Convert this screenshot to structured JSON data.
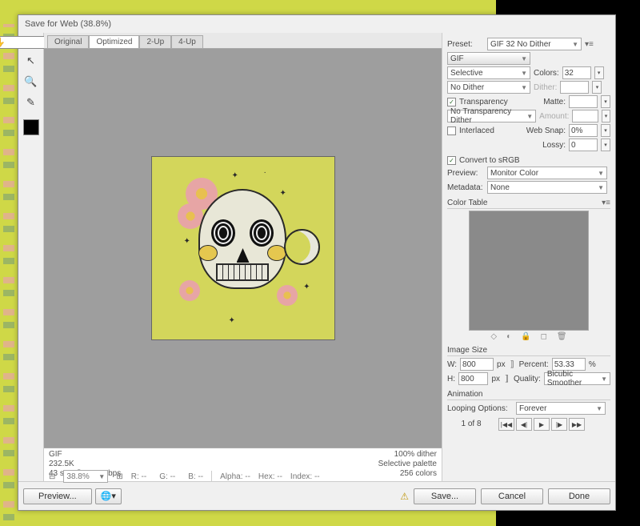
{
  "window": {
    "title": "Save for Web (38.8%)"
  },
  "tabs": [
    "Original",
    "Optimized",
    "2-Up",
    "4-Up"
  ],
  "activeTab": 1,
  "info": {
    "left": [
      "GIF",
      "232.5K",
      "43 sec @ 56.6 Kbps"
    ],
    "right": [
      "100% dither",
      "Selective palette",
      "256 colors"
    ]
  },
  "zoom": "38.8%",
  "stats": {
    "r": "R: --",
    "g": "G: --",
    "b": "B: --",
    "alpha": "Alpha: --",
    "hex": "Hex: --",
    "index": "Index: --"
  },
  "preset": {
    "label": "Preset:",
    "value": "GIF 32 No Dither",
    "format": "GIF",
    "palette": "Selective",
    "colorsLabel": "Colors:",
    "colors": "32",
    "dither": "No Dither",
    "ditherLabel": "Dither:",
    "transparency": "Transparency",
    "transparencyChecked": true,
    "matteLabel": "Matte:",
    "tdither": "No Transparency Dither",
    "amountLabel": "Amount:",
    "interlaced": "Interlaced",
    "interlacedChecked": false,
    "websnapLabel": "Web Snap:",
    "websnap": "0%",
    "lossyLabel": "Lossy:",
    "lossy": "0",
    "convertSRGB": "Convert to sRGB",
    "convertSRGBChecked": true,
    "previewLabel": "Preview:",
    "preview": "Monitor Color",
    "metadataLabel": "Metadata:",
    "metadata": "None"
  },
  "colorTable": {
    "title": "Color Table"
  },
  "imageSize": {
    "title": "Image Size",
    "wlabel": "W:",
    "w": "800",
    "wunits": "px",
    "hlabel": "H:",
    "h": "800",
    "hunits": "px",
    "percentLabel": "Percent:",
    "percent": "53.33",
    "pctUnit": "%",
    "qualityLabel": "Quality:",
    "quality": "Bicubic Smoother"
  },
  "animation": {
    "title": "Animation",
    "loopLabel": "Looping Options:",
    "loop": "Forever",
    "frame": "1 of 8"
  },
  "buttons": {
    "preview": "Preview...",
    "save": "Save...",
    "cancel": "Cancel",
    "done": "Done"
  }
}
